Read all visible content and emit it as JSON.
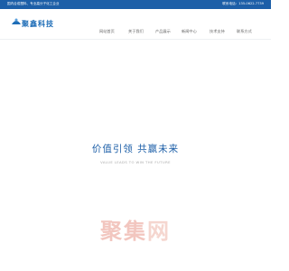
{
  "topbar": {
    "tagline": "国内合成塑料、专业高分子化工企业",
    "hotline": "联系电话：135-0622-7739"
  },
  "logo": {
    "icon": "logo-icon",
    "text": "聚鑫科技"
  },
  "nav": {
    "items": [
      {
        "label": "网站首页"
      },
      {
        "label": "关于我们"
      },
      {
        "label": "产品展示"
      },
      {
        "label": "新闻中心"
      },
      {
        "label": "技术支持"
      },
      {
        "label": "联系方式"
      }
    ]
  },
  "slogan": {
    "title": "价值引领 共赢未来",
    "subtitle": "VALUE LEADS TO WIN THE FUTURE"
  },
  "watermark": {
    "part1": "聚集",
    "part2": "网"
  },
  "colors": {
    "accent": "#1d5fa8",
    "logo": "#1e6db7",
    "watermark": "#f2c6bf"
  }
}
